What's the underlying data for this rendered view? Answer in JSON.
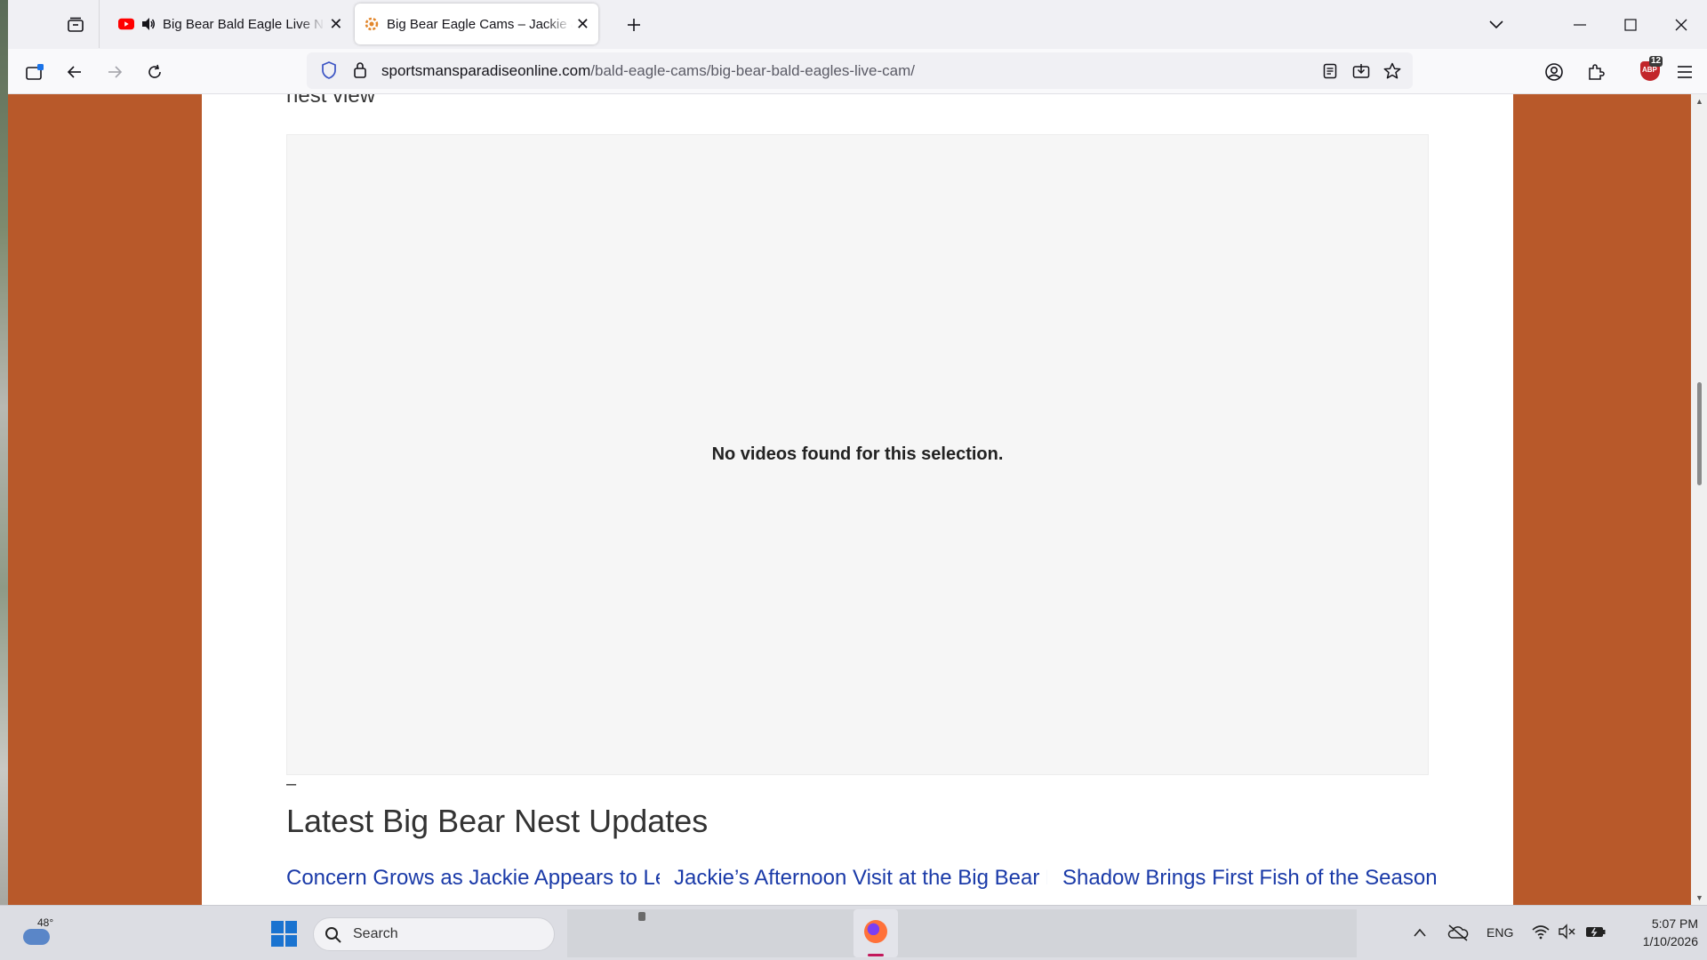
{
  "browser": {
    "tabs": [
      {
        "title": "Big Bear Bald Eagle Live Nest",
        "state": "inactive",
        "favicon": "youtube-icon",
        "audio": "playing"
      },
      {
        "title": "Big Bear Eagle Cams – Jackie & Shadow",
        "state": "active",
        "favicon": "site-icon"
      }
    ],
    "url_domain": "sportsmansparadiseonline.com",
    "url_path": "/bald-eagle-cams/big-bear-bald-eagles-live-cam/",
    "extension_badge": "12",
    "extension_label": "ABP"
  },
  "page": {
    "section_heading": "nest view",
    "video_message": "No videos found for this selection.",
    "dash": "–",
    "updates_title": "Latest Big Bear Nest Updates",
    "posts": [
      {
        "title": "Concern Grows as Jackie Appears to Leave Her Egg at the Big Bear Eagle Nest"
      },
      {
        "title": "Jackie’s Afternoon Visit at the Big Bear Eagle Nest Leads to an Unexpected"
      },
      {
        "title": "Shadow Brings First Fish of the Season as Nest Readies for Eggs in Big Bear"
      }
    ],
    "colors": {
      "page_bg": "#b8592a",
      "link": "#1a3aa8"
    }
  },
  "taskbar": {
    "weather_temp": "48°",
    "search_placeholder": "Search",
    "language": "ENG",
    "time": "5:07 PM",
    "date": "1/10/2026"
  }
}
